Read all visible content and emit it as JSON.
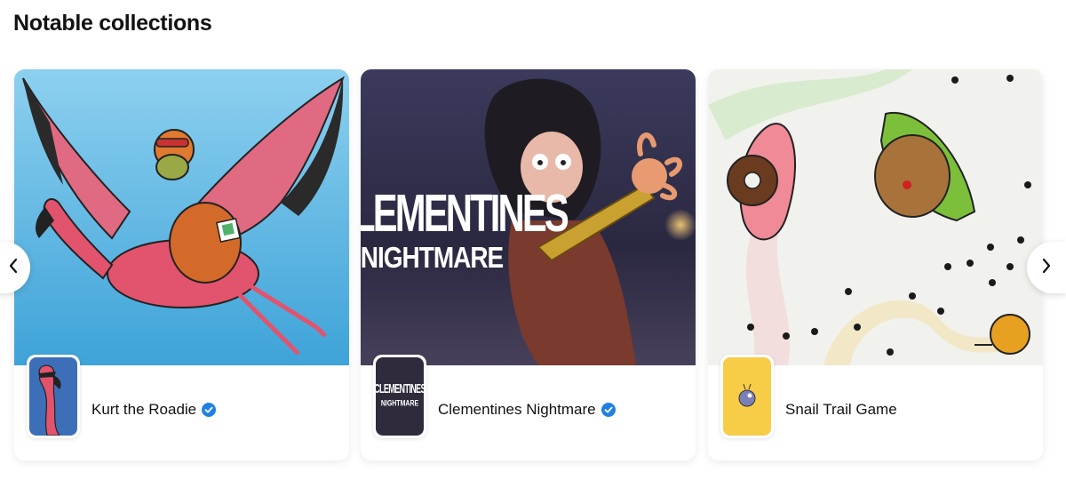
{
  "section": {
    "title": "Notable collections"
  },
  "navigation": {
    "prev_icon": "chevron-left-icon",
    "next_icon": "chevron-right-icon"
  },
  "collections": [
    {
      "name": "Kurt the Roadie",
      "verified": true,
      "banner_colors": [
        "#7fc7ea",
        "#48a9dc"
      ],
      "accent": "#e2536d"
    },
    {
      "name": "Clementines Nightmare",
      "verified": true,
      "banner_title": "CLEMENTINES",
      "banner_subtitle": "NIGHTMARE",
      "logo_title": "CLEMENTINES",
      "logo_subtitle": "NIGHTMARE",
      "banner_colors": [
        "#2b2941",
        "#5a5070"
      ],
      "accent": "#c9a130"
    },
    {
      "name": "Snail Trail Game",
      "verified": false,
      "banner_colors": [
        "#eef1ea",
        "#f5f5f2"
      ],
      "accent": "#f5c94a"
    }
  ],
  "colors": {
    "verified_badge": "#2081e2",
    "text_primary": "#121212"
  }
}
